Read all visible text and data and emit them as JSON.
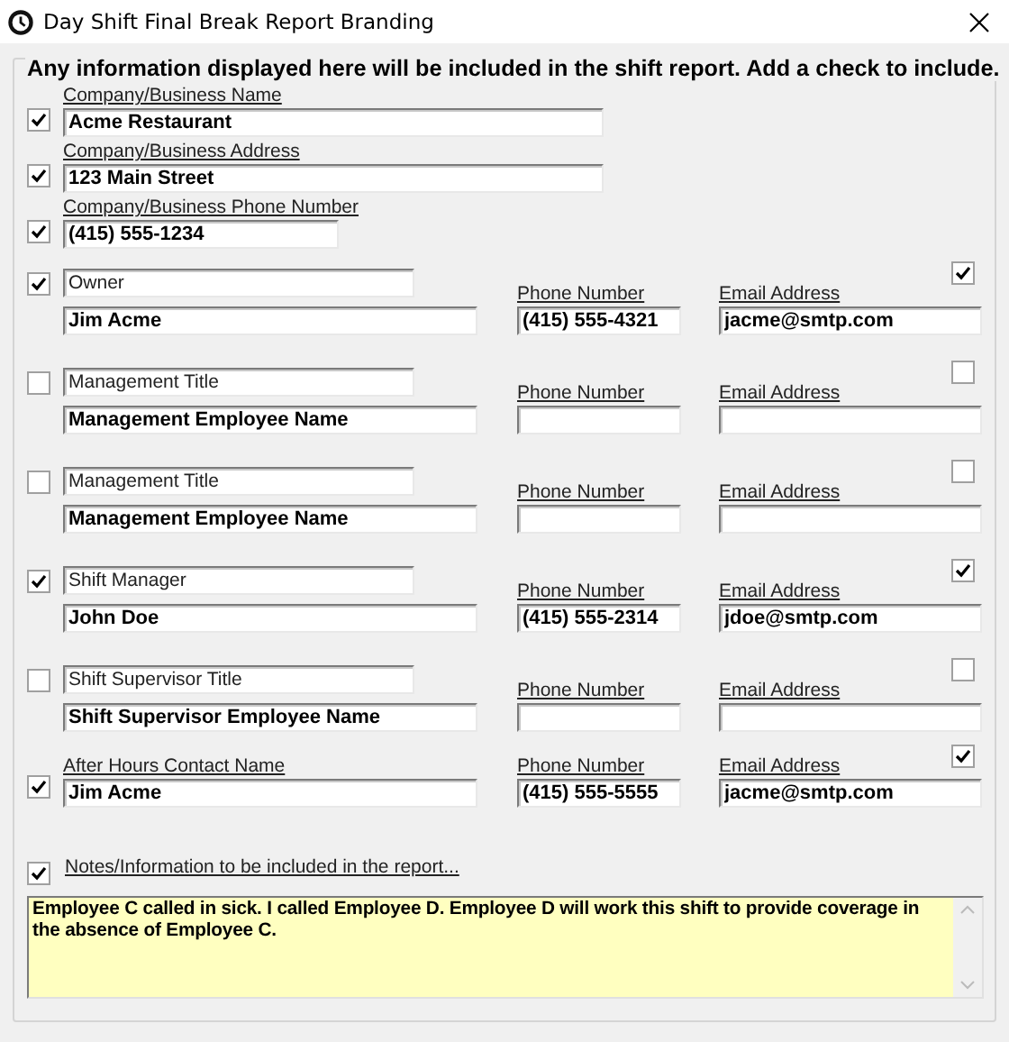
{
  "window": {
    "title": "Day Shift Final Break Report Branding"
  },
  "group": {
    "legend": "Any information displayed here will be included in the shift report. Add a check to include."
  },
  "company_fields": [
    {
      "label": "Company/Business Name",
      "value": "Acme Restaurant",
      "checked": true,
      "kind": "long"
    },
    {
      "label": "Company/Business  Address",
      "value": "123 Main Street",
      "checked": true,
      "kind": "long"
    },
    {
      "label": "Company/Business  Phone Number",
      "value": "(415) 555-1234",
      "checked": true,
      "kind": "short"
    }
  ],
  "contacts": [
    {
      "kind": "titled",
      "checked": true,
      "title": "Owner",
      "name": "Jim Acme",
      "phone_label": "Phone Number",
      "phone": "(415) 555-4321",
      "email_label": "Email Address",
      "email": "jacme@smtp.com",
      "email_checked": true
    },
    {
      "kind": "titled",
      "checked": false,
      "title": "Management Title",
      "name": "Management Employee Name",
      "phone_label": "Phone Number",
      "email_label": "Email Address",
      "email_checked": false
    },
    {
      "kind": "titled",
      "checked": false,
      "title": "Management Title",
      "name": "Management Employee Name",
      "phone_label": "Phone Number",
      "email_label": "Email Address",
      "email_checked": false
    },
    {
      "kind": "titled",
      "checked": true,
      "title": "Shift Manager",
      "name": "John Doe",
      "phone_label": "Phone Number",
      "phone": "(415) 555-2314",
      "email_label": "Email Address",
      "email": "jdoe@smtp.com",
      "email_checked": true
    },
    {
      "kind": "titled",
      "checked": false,
      "title": "Shift Supervisor Title",
      "name": "Shift Supervisor Employee Name",
      "phone_label": "Phone Number",
      "email_label": "Email Address",
      "email_checked": false
    },
    {
      "kind": "labeled",
      "checked": true,
      "label": "After Hours Contact Name",
      "name": "Jim Acme",
      "phone_label": "Phone Number",
      "phone": "(415) 555-5555",
      "email_label": "Email Address",
      "email": "jacme@smtp.com",
      "email_checked": true
    }
  ],
  "notes": {
    "label": "Notes/Information to be included in the report...",
    "text": "Employee C called in sick. I called Employee D. Employee D will work this shift to provide coverage in the absence of Employee C.",
    "checked": true
  }
}
